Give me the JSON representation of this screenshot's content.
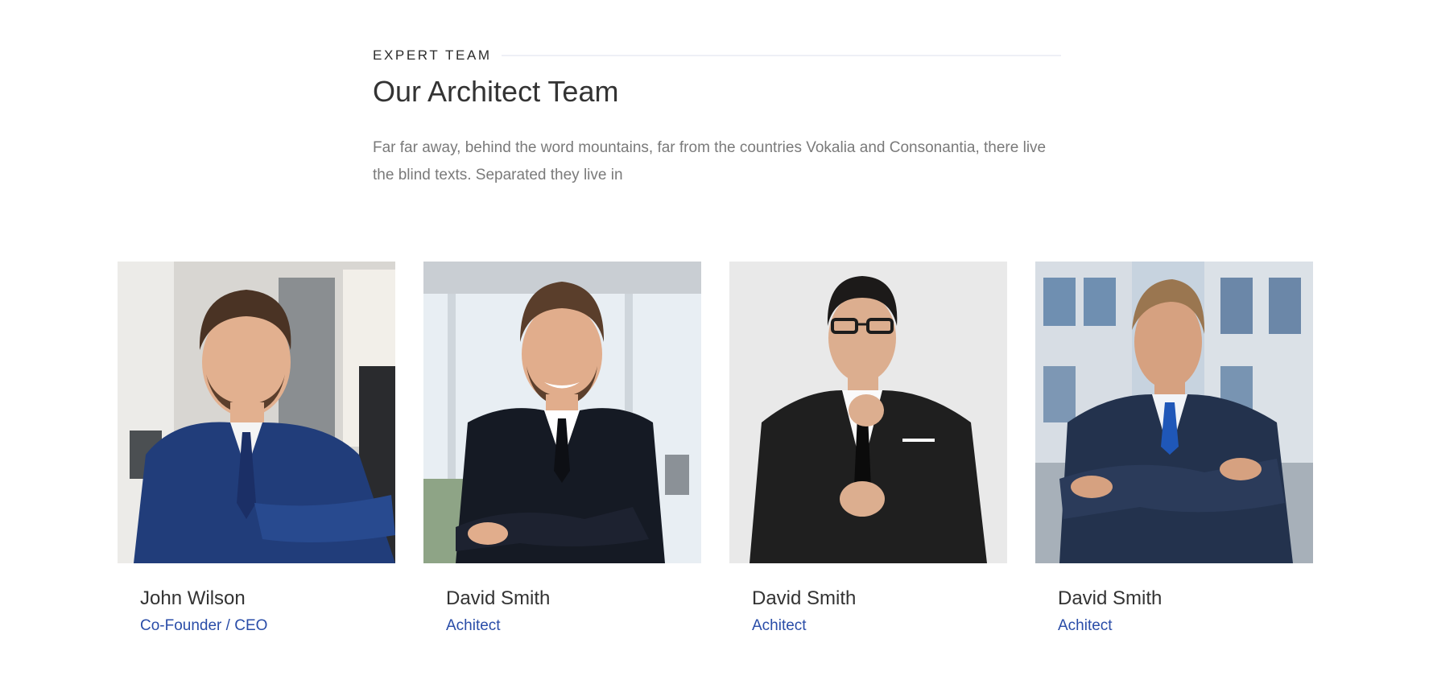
{
  "header": {
    "eyebrow": "EXPERT TEAM",
    "title": "Our Architect Team",
    "intro": "Far far away, behind the word mountains, far from the countries Vokalia and Consonantia, there live the blind texts. Separated they live in"
  },
  "team": [
    {
      "name": "John Wilson",
      "role": "Co-Founder / CEO"
    },
    {
      "name": "David Smith",
      "role": "Achitect"
    },
    {
      "name": "David Smith",
      "role": "Achitect"
    },
    {
      "name": "David Smith",
      "role": "Achitect"
    }
  ],
  "colors": {
    "accent": "#2a4da8",
    "heading": "#333333",
    "body_text": "#7a7a7a"
  }
}
